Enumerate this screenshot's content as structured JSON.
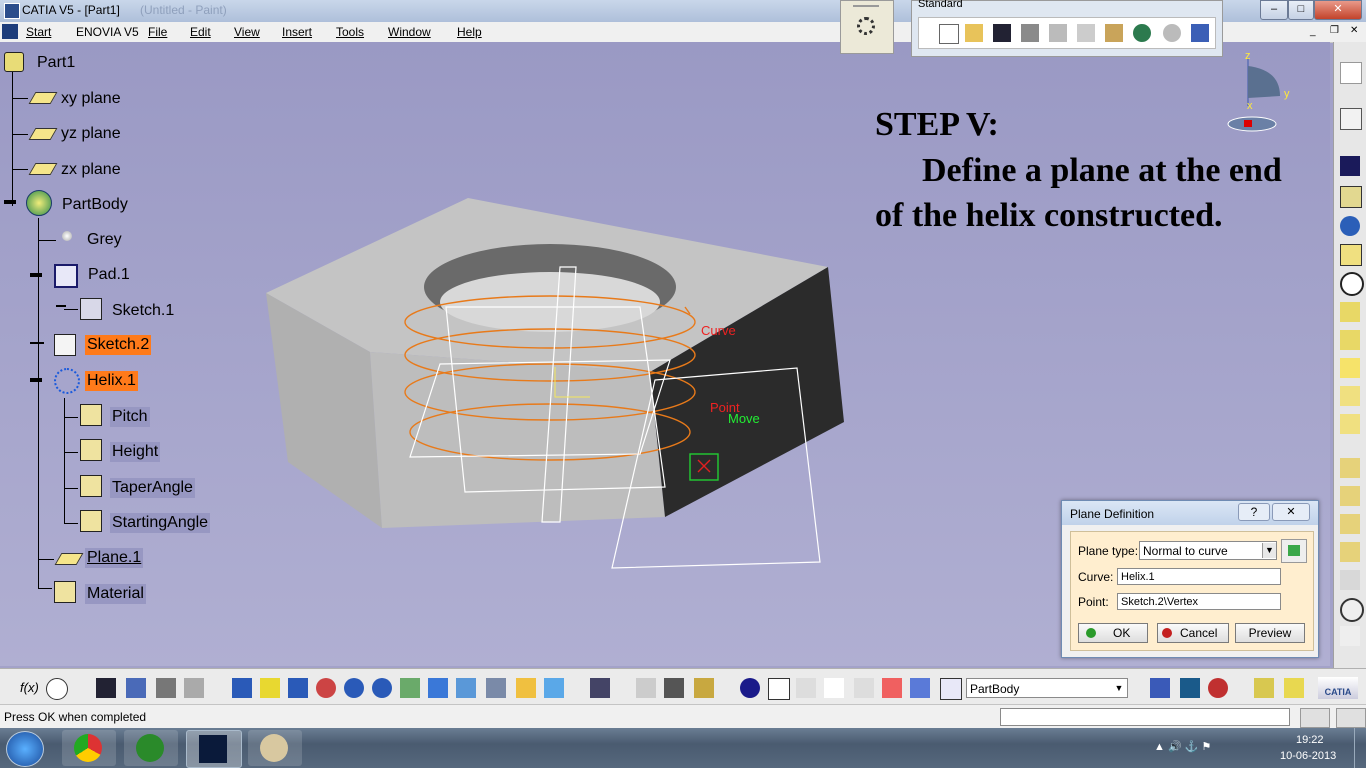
{
  "window": {
    "title": "CATIA V5 - [Part1]",
    "ghost_title": "(Untitled - Paint)"
  },
  "menu": [
    "Start",
    "ENOVIA V5",
    "File",
    "Edit",
    "View",
    "Insert",
    "Tools",
    "Window",
    "Help"
  ],
  "standard_toolbar": {
    "title": "Standard"
  },
  "tree": {
    "root": "Part1",
    "planes": [
      "xy plane",
      "yz plane",
      "zx plane"
    ],
    "body": "PartBody",
    "grey": "Grey",
    "pad": "Pad.1",
    "sketch1": "Sketch.1",
    "sketch2": "Sketch.2",
    "helix": "Helix.1",
    "helix_params": [
      "Pitch",
      "Height",
      "TaperAngle",
      "StartingAngle"
    ],
    "plane1": "Plane.1",
    "material": "Material"
  },
  "annotation": {
    "line1": "STEP V:",
    "line2": "Define a plane at the end",
    "line3": "of the helix constructed."
  },
  "viewport_labels": {
    "curve": "Curve",
    "point": "Point",
    "move": "Move"
  },
  "compass": {
    "z": "z",
    "y": "y",
    "x": "x"
  },
  "dialog": {
    "title": "Plane Definition",
    "help": "?",
    "close": "✕",
    "plane_type_label": "Plane type:",
    "plane_type_value": "Normal to curve",
    "curve_label": "Curve:",
    "curve_value": "Helix.1",
    "point_label": "Point:",
    "point_value": "Sketch.2\\Vertex",
    "ok": "OK",
    "cancel": "Cancel",
    "preview": "Preview"
  },
  "bottom_toolbar": {
    "body_select": "PartBody",
    "fx": "f(x)"
  },
  "status": {
    "text": "Press OK when completed"
  },
  "taskbar": {
    "time": "19:22",
    "date": "10-06-2013"
  },
  "colors": {
    "accent": "#ff7a1a",
    "helix": "#e87a1a",
    "viewport": "#a3a2c9",
    "ok_green": "#2a9a2a",
    "cancel_red": "#c42020"
  }
}
